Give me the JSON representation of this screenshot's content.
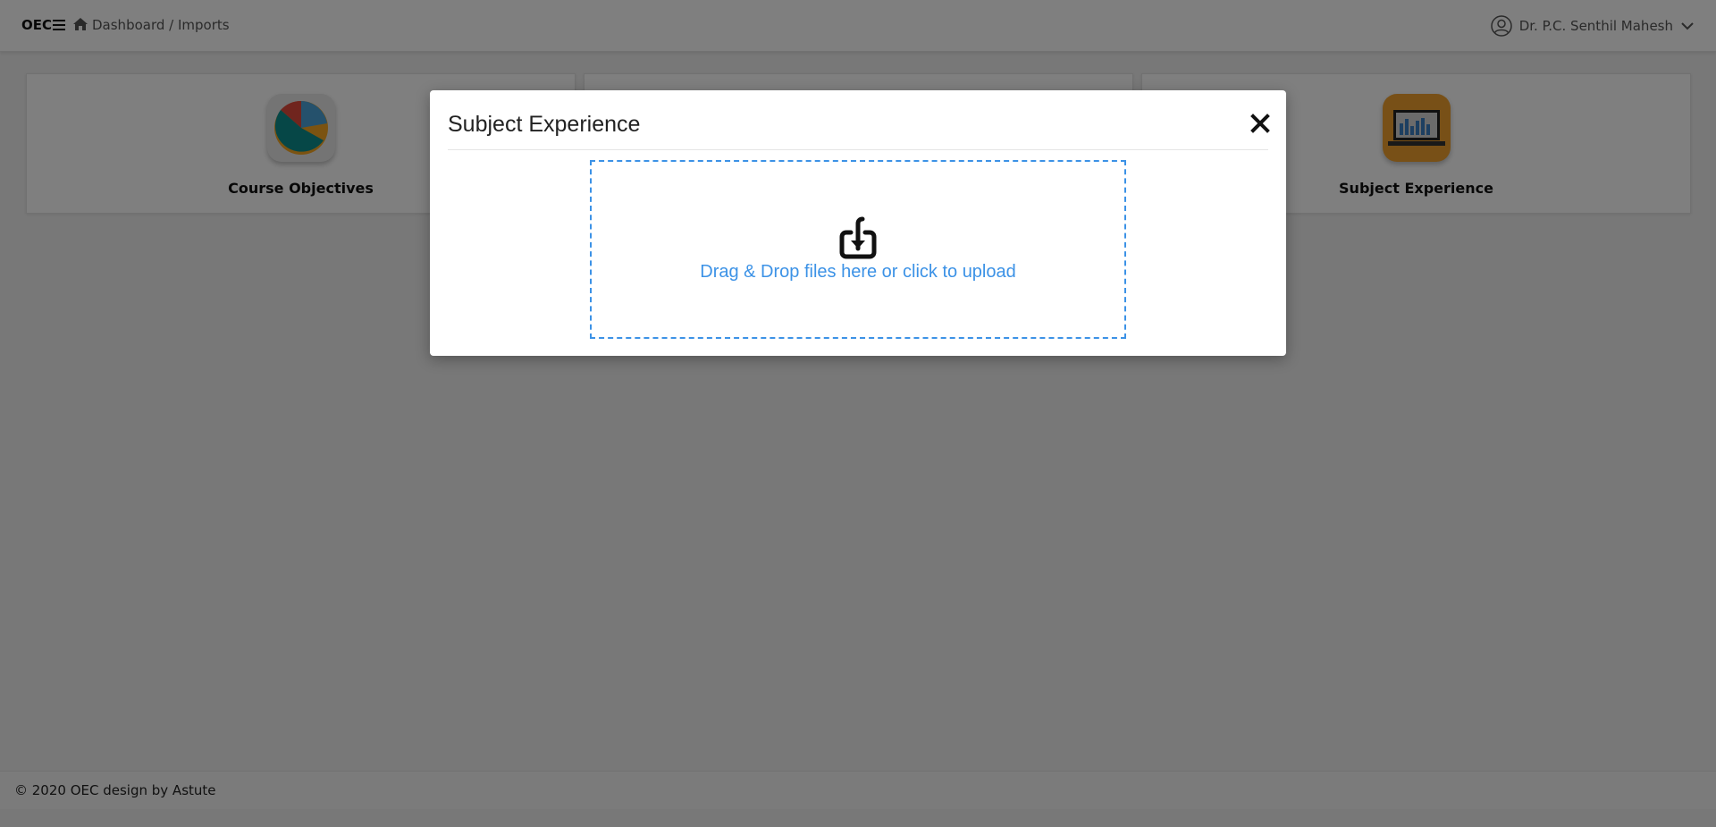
{
  "header": {
    "brand": "OEC",
    "breadcrumb": {
      "dashboard": "Dashboard",
      "separator": " / ",
      "current": "Imports"
    },
    "user_name": "Dr. P.C. Senthil Mahesh"
  },
  "cards": [
    {
      "label": "Course Objectives",
      "icon": "pie-chart-icon"
    },
    {
      "label": "",
      "icon": ""
    },
    {
      "label": "Subject Experience",
      "icon": "bar-chart-laptop-icon"
    }
  ],
  "modal": {
    "title": "Subject Experience",
    "dropzone_text": "Drag & Drop files here or click to upload"
  },
  "footer": {
    "text": "© 2020 OEC design by Astute"
  },
  "colors": {
    "accent": "#3c92e6",
    "overlay": "rgba(0,0,0,0.5)",
    "icon_orange": "#f0a12f"
  }
}
